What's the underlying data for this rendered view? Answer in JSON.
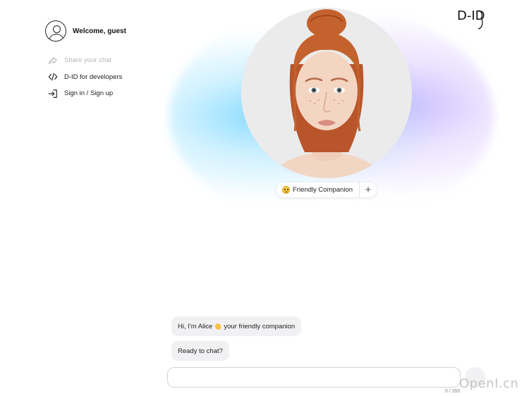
{
  "sidebar": {
    "welcome": "Welcome, guest",
    "items": [
      {
        "label": "Share your chat",
        "icon": "share-icon",
        "disabled": true
      },
      {
        "label": "D-ID for developers",
        "icon": "code-icon",
        "disabled": false
      },
      {
        "label": "Sign in / Sign up",
        "icon": "sign-in-icon",
        "disabled": false
      }
    ]
  },
  "logo": {
    "text": "D-ID"
  },
  "persona": {
    "emoji": "smiling-face",
    "label": "Friendly Companion",
    "add_label": "+"
  },
  "chat": {
    "messages": [
      {
        "before": "Hi, I'm Alice",
        "emoji": "waving-hand",
        "after": "your friendly companion"
      },
      {
        "text": "Ready to chat?"
      }
    ],
    "input": {
      "value": "",
      "placeholder": ""
    },
    "counter": "0 / 350"
  },
  "watermark": "OpenI.cn",
  "colors": {
    "glow_cyan": "#78d7ff",
    "glow_purple": "#beaaff",
    "bubble_bg": "#f1f1f3",
    "hair": "#c4622d"
  }
}
